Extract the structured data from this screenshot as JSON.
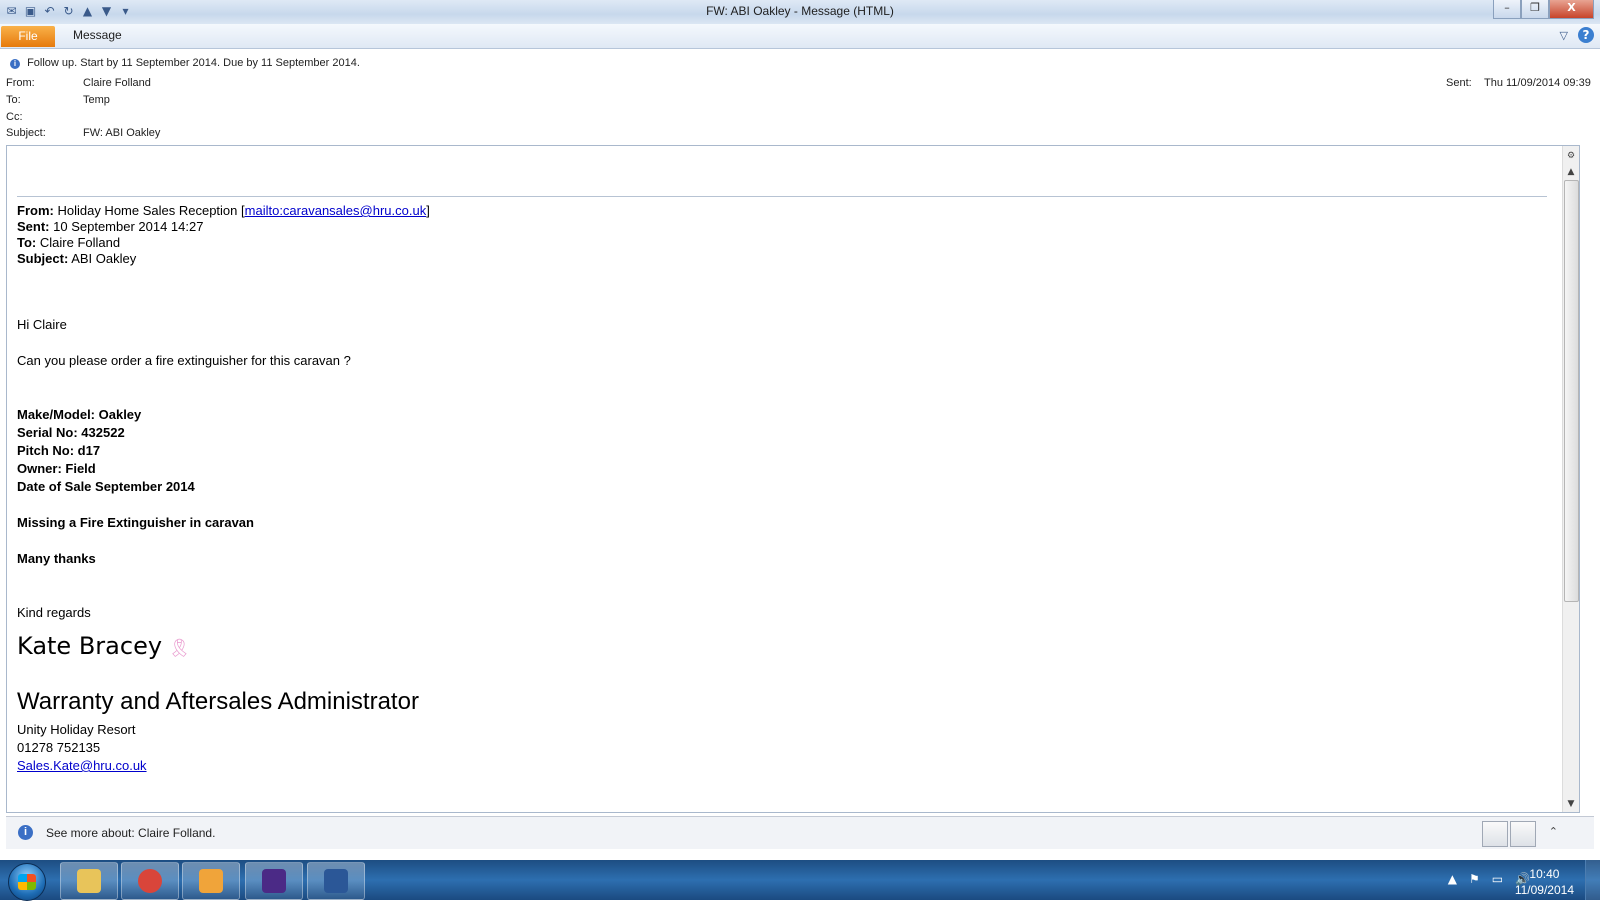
{
  "window": {
    "title": "FW: ABI Oakley - Message (HTML)",
    "controls": {
      "minimize": "–",
      "restore": "❐",
      "close": "X"
    }
  },
  "quick_access": [
    {
      "name": "outlook-icon",
      "glyph": "✉"
    },
    {
      "name": "save-icon",
      "glyph": "▣"
    },
    {
      "name": "undo-icon",
      "glyph": "↶"
    },
    {
      "name": "redo-icon",
      "glyph": "↻"
    },
    {
      "name": "previous-item-icon",
      "glyph": "▲"
    },
    {
      "name": "next-item-icon",
      "glyph": "▼"
    },
    {
      "name": "customize-qat-icon",
      "glyph": "▾"
    }
  ],
  "ribbon": {
    "file_tab": "File",
    "message_tab": "Message",
    "minimize_glyph": "▽",
    "help_glyph": "?"
  },
  "header": {
    "follow_up": "Follow up.  Start by 11 September 2014.  Due by 11 September 2014.",
    "from_label": "From:",
    "from_value": "Claire Folland",
    "to_label": "To:",
    "to_value": "Temp",
    "cc_label": "Cc:",
    "subject_label": "Subject:",
    "subject_value": "FW: ABI Oakley",
    "sent_label": "Sent:",
    "sent_value": "Thu 11/09/2014 09:39"
  },
  "forwarded": {
    "from_label": "From:",
    "from_name": "Holiday Home Sales Reception",
    "from_link": "mailto:caravansales@hru.co.uk",
    "sent_label": "Sent:",
    "sent_value": "10 September 2014 14:27",
    "to_label": "To:",
    "to_value": "Claire Folland",
    "subject_label": "Subject:",
    "subject_value": "ABI Oakley"
  },
  "body": {
    "greeting": "Hi  Claire",
    "request": "Can you please order a fire extinguisher for this caravan ?",
    "make_model": "Make/Model:  Oakley",
    "serial": "Serial No: 432522",
    "pitch": "Pitch No: d17",
    "owner": "Owner: Field",
    "date_of_sale": "Date of Sale September 2014",
    "missing": "Missing a Fire Extinguisher in caravan",
    "thanks": "Many thanks",
    "regards": "Kind regards"
  },
  "signature": {
    "name": "Kate Bracey",
    "ribbon_glyph": "🎗",
    "title": "Warranty and Aftersales Administrator",
    "company": "Unity Holiday Resort",
    "phone": "01278 752135",
    "email": "Sales.Kate@hru.co.uk"
  },
  "people_pane": {
    "text": "See more about: Claire Folland.",
    "collapse_glyph": "⌃"
  },
  "taskbar": {
    "clock_time": "10:40",
    "clock_date": "11/09/2014",
    "apps": [
      {
        "name": "explorer-icon",
        "color": "#e8c45a"
      },
      {
        "name": "chrome-icon",
        "color": "#d9453a"
      },
      {
        "name": "outlook-task-icon",
        "color": "#f0a43a"
      },
      {
        "name": "calendar-app-icon",
        "color": "#4b2a86"
      },
      {
        "name": "word-icon",
        "color": "#2b5797"
      }
    ],
    "tray": [
      "▲",
      "⚑",
      "▭",
      "🔊"
    ]
  }
}
